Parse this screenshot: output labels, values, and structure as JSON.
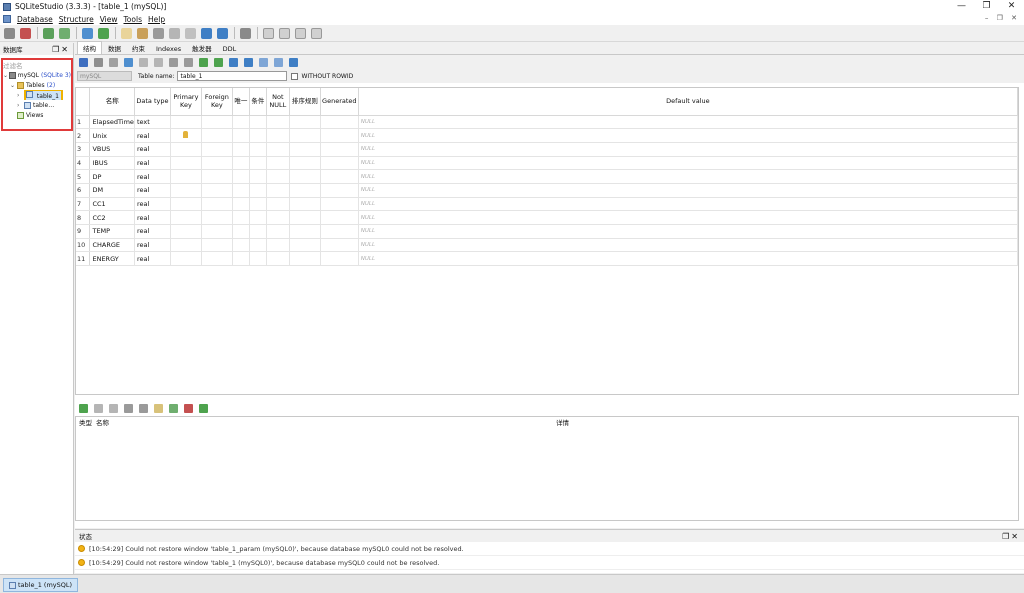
{
  "window": {
    "title": "SQLiteStudio (3.3.3) - [table_1 (mySQL)]",
    "controls": [
      "—",
      "❐",
      "✕"
    ]
  },
  "menu": [
    "Database",
    "Structure",
    "View",
    "Tools",
    "Help"
  ],
  "mdi_controls": "– ❐ ✕",
  "db_dock": {
    "title": "数据库",
    "filter_placeholder": "过滤名",
    "tree": {
      "db_name": "mySQL",
      "db_type": "(SQLite 3)",
      "tables_label": "Tables",
      "tables_count": "(2)",
      "table1": "table_1",
      "table2": "table…",
      "views_label": "Views"
    }
  },
  "tabs": [
    "结构",
    "数据",
    "约束",
    "Indexes",
    "触发器",
    "DDL"
  ],
  "name_row": {
    "database": "mySQL",
    "table_name_label": "Table name:",
    "table_name_value": "table_1",
    "without_rowid_label": "WITHOUT ROWID"
  },
  "columns_header": {
    "name": "名称",
    "type": "Data type",
    "pk": "Primary Key",
    "fk": "Foreign Key",
    "unique": "唯一",
    "check": "条件",
    "notnull": "Not NULL",
    "collate": "排序规则",
    "generated": "Generated",
    "default": "Default value"
  },
  "columns": [
    {
      "num": "1",
      "name": "ElapsedTime",
      "type": "text",
      "pk": false,
      "default": "NULL"
    },
    {
      "num": "2",
      "name": "Unix",
      "type": "real",
      "pk": true,
      "default": "NULL"
    },
    {
      "num": "3",
      "name": "VBUS",
      "type": "real",
      "pk": false,
      "default": "NULL"
    },
    {
      "num": "4",
      "name": "IBUS",
      "type": "real",
      "pk": false,
      "default": "NULL"
    },
    {
      "num": "5",
      "name": "DP",
      "type": "real",
      "pk": false,
      "default": "NULL"
    },
    {
      "num": "6",
      "name": "DM",
      "type": "real",
      "pk": false,
      "default": "NULL"
    },
    {
      "num": "7",
      "name": "CC1",
      "type": "real",
      "pk": false,
      "default": "NULL"
    },
    {
      "num": "8",
      "name": "CC2",
      "type": "real",
      "pk": false,
      "default": "NULL"
    },
    {
      "num": "9",
      "name": "TEMP",
      "type": "real",
      "pk": false,
      "default": "NULL"
    },
    {
      "num": "10",
      "name": "CHARGE",
      "type": "real",
      "pk": false,
      "default": "NULL"
    },
    {
      "num": "11",
      "name": "ENERGY",
      "type": "real",
      "pk": false,
      "default": "NULL"
    }
  ],
  "constraints_panel": {
    "type_header": "类型",
    "name_header": "名称",
    "details_header": "详情"
  },
  "status_dock": {
    "title": "状态",
    "messages": [
      "[10:54:29]  Could not restore window 'table_1_param (mySQL0)', because database mySQL0 could not be resolved.",
      "[10:54:29]  Could not restore window 'table_1 (mySQL0)', because database mySQL0 could not be resolved."
    ]
  },
  "taskbar": {
    "item": "table_1 (mySQL)"
  },
  "colors": {
    "highlight_red": "#e03a3a",
    "selection_orange": "#f0b300",
    "link_blue": "#2a4ec9"
  }
}
